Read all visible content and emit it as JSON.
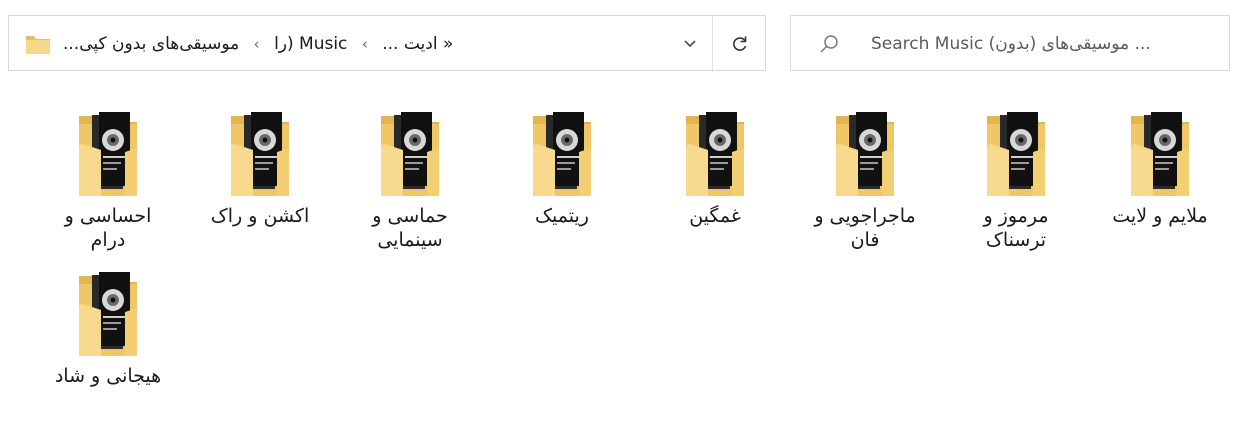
{
  "address_bar": {
    "overflow_chevron": "«",
    "breadcrumbs": [
      "ادیت ...",
      "Music (را",
      "موسیقی‌های بدون کپی...",
      ""
    ]
  },
  "search": {
    "placeholder": "Search Music (بدون) موسیقی‌های ..."
  },
  "folders": [
    {
      "label": "ملایم و لایت"
    },
    {
      "label": "مرموز و ترسناک"
    },
    {
      "label": "ماجراجویی و فان"
    },
    {
      "label": "غمگین"
    },
    {
      "label": "ریتمیک"
    },
    {
      "label": "حماسی و سینمایی"
    },
    {
      "label": "اکشن و راک"
    },
    {
      "label": "احساسی و درام"
    },
    {
      "label": "هیجانی و شاد"
    }
  ],
  "colors": {
    "folder_back": "#e8c05a",
    "folder_front": "#f7d889",
    "cover_dark": "#1c1c1c",
    "border": "#d9d9d9"
  }
}
